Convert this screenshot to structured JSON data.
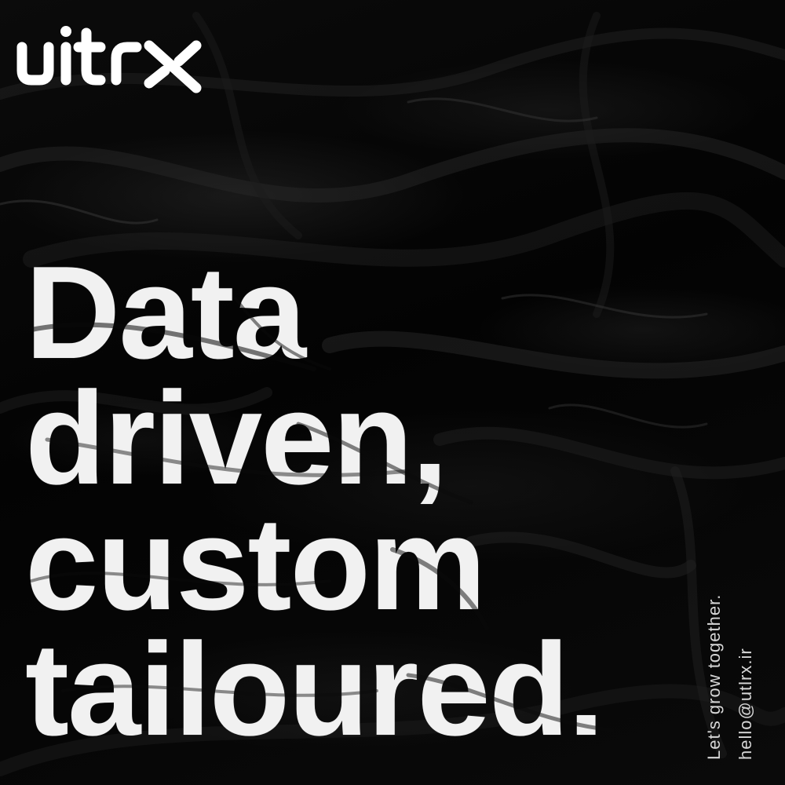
{
  "brand": {
    "logo_text": "uitrx"
  },
  "headline": {
    "lines": [
      "Data",
      "driven,",
      "custom",
      "tailoured."
    ]
  },
  "contact": {
    "tagline": "Let's grow together.",
    "email": "hello@utlrx.ir"
  },
  "colors": {
    "background": "#050505",
    "text": "#f1f1f1",
    "secondary_text": "#d6d6d6"
  }
}
